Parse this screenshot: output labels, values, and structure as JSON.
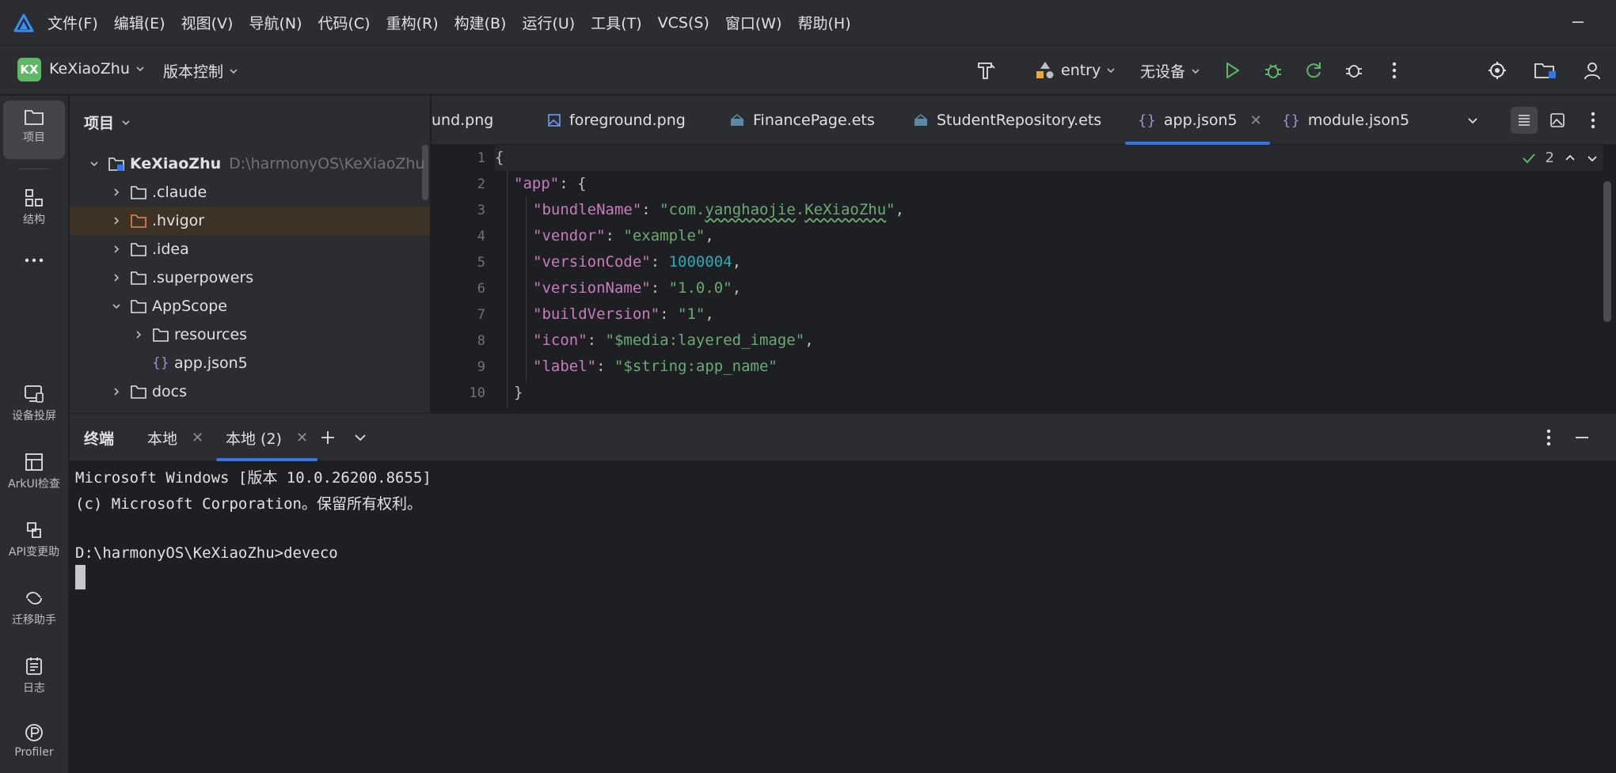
{
  "menubar": {
    "items": [
      "文件(F)",
      "编辑(E)",
      "视图(V)",
      "导航(N)",
      "代码(C)",
      "重构(R)",
      "构建(B)",
      "运行(U)",
      "工具(T)",
      "VCS(S)",
      "窗口(W)",
      "帮助(H)"
    ]
  },
  "toolbar": {
    "project_badge": "KX",
    "project_name": "KeXiaoZhu",
    "vcs_label": "版本控制",
    "module": "entry",
    "device": "无设备"
  },
  "leftstrip": {
    "items": [
      "项目",
      "结构",
      "设备投屏",
      "ArkUI检查",
      "API变更助",
      "迁移助手",
      "日志",
      "Profiler"
    ]
  },
  "project_panel": {
    "title": "项目",
    "root_name": "KeXiaoZhu",
    "root_path": "D:\\harmonyOS\\KeXiaoZhu",
    "rows": [
      ".claude",
      ".hvigor",
      ".idea",
      ".superpowers",
      "AppScope",
      "resources",
      "app.json5",
      "docs"
    ]
  },
  "editor": {
    "tabs": [
      "und.png",
      "foreground.png",
      "FinancePage.ets",
      "StudentRepository.ets",
      "app.json5",
      "module.json5"
    ],
    "line_numbers": [
      "1",
      "2",
      "3",
      "4",
      "5",
      "6",
      "7",
      "8",
      "9",
      "10"
    ],
    "inspection_count": "2",
    "code": {
      "l1": "{",
      "l2_key": "\"app\"",
      "l2_rest": ": {",
      "l3_key": "\"bundleName\"",
      "l3_v1": "\"com.",
      "l3_v2": "yanghaojie",
      "l3_v3": ".",
      "l3_v4": "KeXiaoZhu",
      "l3_v5": "\"",
      "l4_key": "\"vendor\"",
      "l4_val": "\"example\"",
      "l5_key": "\"versionCode\"",
      "l5_val": "1000004",
      "l6_key": "\"versionName\"",
      "l6_val": "\"1.0.0\"",
      "l7_key": "\"buildVersion\"",
      "l7_val": "\"1\"",
      "l8_key": "\"icon\"",
      "l8_val": "\"$media:layered_image\"",
      "l9_key": "\"label\"",
      "l9_val": "\"$string:app_name\"",
      "l10": "}"
    }
  },
  "terminal": {
    "title": "终端",
    "tabs": [
      "本地",
      "本地 (2)"
    ],
    "lines": [
      "Microsoft Windows [版本 10.0.26200.8655]",
      "(c) Microsoft Corporation。保留所有权利。",
      "",
      "D:\\harmonyOS\\KeXiaoZhu>deveco"
    ]
  }
}
